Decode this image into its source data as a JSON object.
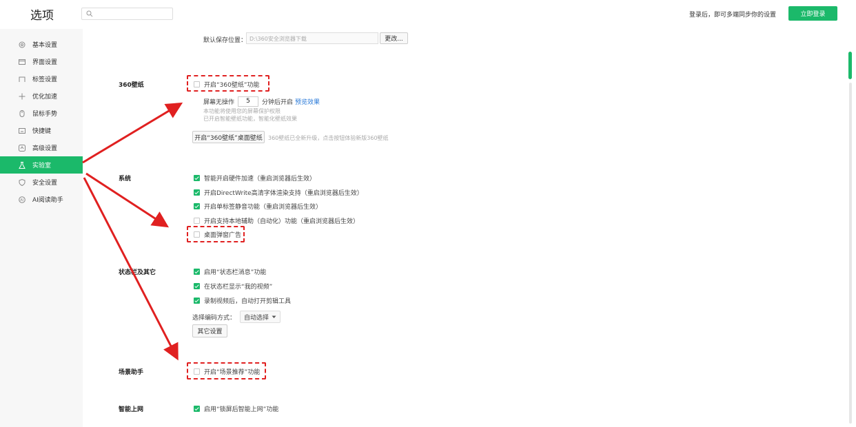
{
  "header": {
    "title": "选项",
    "search_placeholder": "",
    "login_hint": "登录后，即可多端同步你的设置",
    "login_button": "立即登录"
  },
  "sidebar": {
    "items": [
      {
        "label": "基本设置",
        "icon": "settings-icon"
      },
      {
        "label": "界面设置",
        "icon": "window-icon"
      },
      {
        "label": "标签设置",
        "icon": "tab-icon"
      },
      {
        "label": "优化加速",
        "icon": "speed-icon"
      },
      {
        "label": "鼠标手势",
        "icon": "mouse-icon"
      },
      {
        "label": "快捷键",
        "icon": "keyboard-icon"
      },
      {
        "label": "高级设置",
        "icon": "advanced-icon"
      },
      {
        "label": "实验室",
        "icon": "lab-icon",
        "active": true
      },
      {
        "label": "安全设置",
        "icon": "shield-icon"
      },
      {
        "label": "AI阅读助手",
        "icon": "ai-icon"
      }
    ]
  },
  "download": {
    "label": "默认保存位置：",
    "path": "D:\\360安全浏览器下载",
    "change_button": "更改..."
  },
  "wallpaper": {
    "section": "360壁纸",
    "enable_label": "开启“360壁纸”功能",
    "enable_checked": false,
    "idle_prefix": "屏幕无操作",
    "idle_value": "5",
    "idle_suffix": "分钟后开启",
    "preview_link": "预览效果",
    "note1": "本功能将使用您的屏幕保护权限",
    "note2": "已开启智能壁纸功能，智能化壁纸效果",
    "desktop_button": "开启“360壁纸”桌面壁纸",
    "desktop_note": "360壁纸已全新升级，点击按钮体验新版360壁纸"
  },
  "system": {
    "section": "系统",
    "options": [
      {
        "label": "智能开启硬件加速（重启浏览器后生效）",
        "checked": true
      },
      {
        "label": "开启DirectWrite高清字体渲染支持（重启浏览器后生效）",
        "checked": true
      },
      {
        "label": "开启单标签静音功能（重启浏览器后生效）",
        "checked": true
      },
      {
        "label": "开启支持本地辅助（自动化）功能（重启浏览器后生效）",
        "checked": false
      },
      {
        "label": "桌面弹窗广告",
        "checked": false
      }
    ]
  },
  "statusbar": {
    "section": "状态栏及其它",
    "options": [
      {
        "label": "启用“状态栏消息”功能",
        "checked": true
      },
      {
        "label": "在状态栏显示“我的视频”",
        "checked": true
      },
      {
        "label": "录制视频后，自动打开剪辑工具",
        "checked": true
      }
    ],
    "encode_label": "选择编码方式：",
    "encode_value": "自动选择",
    "other_button": "其它设置"
  },
  "scene": {
    "section": "场景助手",
    "enable_label": "开启“场景推荐”功能",
    "enable_checked": false
  },
  "smart": {
    "section": "智能上网",
    "enable_label": "启用“锁屏后智能上网”功能",
    "enable_checked": true
  },
  "colors": {
    "accent": "#1bb96a",
    "annotation": "#e02020"
  }
}
